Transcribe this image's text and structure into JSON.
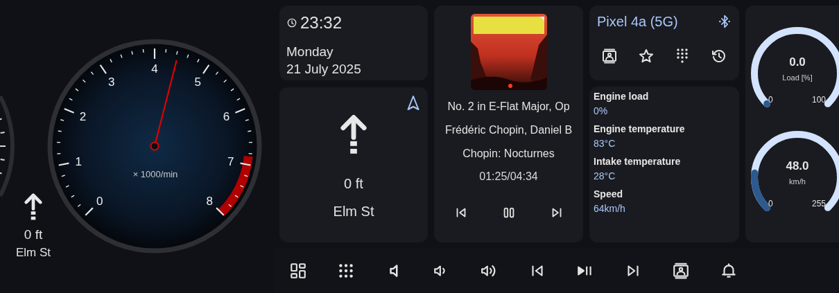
{
  "tachometer": {
    "scale_labels": [
      "0",
      "1",
      "2",
      "3",
      "4",
      "5",
      "6",
      "7",
      "8"
    ],
    "unit": "× 1000/min"
  },
  "side_navigation": {
    "distance": "0 ft",
    "street": "Elm St"
  },
  "clock": {
    "time": "23:32",
    "weekday": "Monday",
    "date": "21 July 2025"
  },
  "navigation": {
    "distance": "0 ft",
    "street": "Elm St"
  },
  "media": {
    "title": "No. 2 in E-Flat Major, Op",
    "artist": "Frédéric Chopin, Daniel B",
    "album": "Chopin: Nocturnes",
    "position": "01:25/04:34",
    "playing": true
  },
  "phone": {
    "device": "Pixel 4a (5G)"
  },
  "readings": [
    {
      "label": "Engine load",
      "value": "0%"
    },
    {
      "label": "Engine temperature",
      "value": "83°C"
    },
    {
      "label": "Intake temperature",
      "value": "28°C"
    },
    {
      "label": "Speed",
      "value": "64km/h"
    }
  ],
  "gauges": [
    {
      "value": "0.0",
      "unit": "Load [%]",
      "min": "0",
      "max": "100"
    },
    {
      "value": "48.0",
      "unit": "km/h",
      "min": "0",
      "max": "255"
    }
  ]
}
